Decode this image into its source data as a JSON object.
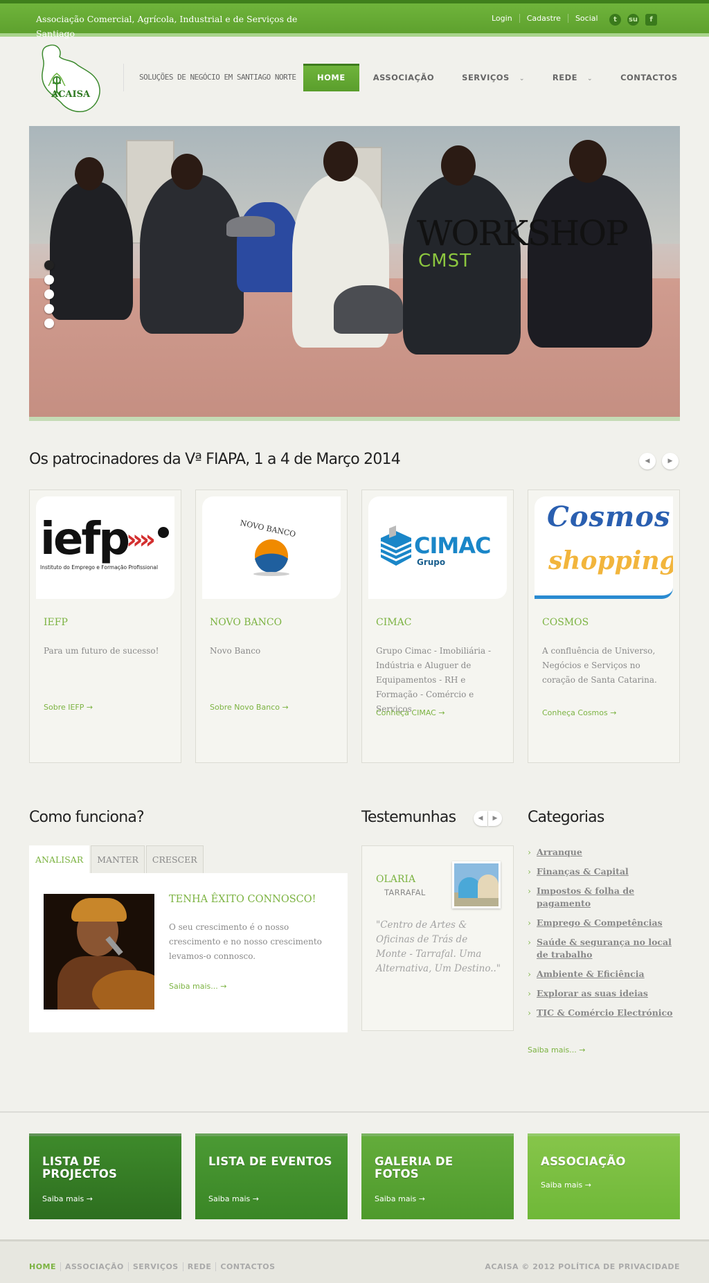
{
  "topbar": {
    "tagline": "Associação Comercial, Agrícola, Industrial e de Serviços de Santiago",
    "links": [
      "Login",
      "Cadastre",
      "Social"
    ],
    "socials": [
      {
        "icon": "twitter-bird-icon",
        "glyph": "t"
      },
      {
        "icon": "stumbleupon-icon",
        "glyph": "su"
      },
      {
        "icon": "facebook-icon",
        "glyph": "f"
      }
    ]
  },
  "header": {
    "logo_text": "ACAISA",
    "tagline": "SOLUÇÕES DE NEGÓCIO EM SANTIAGO NORTE",
    "nav": [
      {
        "label": "HOME",
        "active": true,
        "dropdown": false
      },
      {
        "label": "ASSOCIAÇÃO",
        "active": false,
        "dropdown": false
      },
      {
        "label": "SERVIÇOS",
        "active": false,
        "dropdown": true
      },
      {
        "label": "REDE",
        "active": false,
        "dropdown": true
      },
      {
        "label": "CONTACTOS",
        "active": false,
        "dropdown": false
      }
    ]
  },
  "slider": {
    "title": "WORKSHOP",
    "subtitle": "CMST",
    "slide_count": 5,
    "active_slide": 0
  },
  "sponsors": {
    "heading": "Os patrocinadores da Vª FIAPA, 1 a 4 de Março 2014",
    "cards": [
      {
        "name": "IEFP",
        "logo_main": "iefp",
        "logo_sub": "Instituto do Emprego e Formação Profissional",
        "description": "Para um futuro de sucesso!",
        "link": "Sobre IEFP"
      },
      {
        "name": "NOVO BANCO",
        "logo_main": "NOVO BANCO",
        "logo_sub": "",
        "description": "Novo Banco",
        "link": "Sobre Novo Banco"
      },
      {
        "name": "CIMAC",
        "logo_main": "CIMAC",
        "logo_sub": "Grupo",
        "description": "Grupo Cimac - Imobiliária - Indústria e Aluguer de Equipamentos - RH e Formação - Comércio e Serviços",
        "link": "Conheça CIMAC"
      },
      {
        "name": "COSMOS",
        "logo_main": "Cosmos",
        "logo_sub": "shopping",
        "description": "A confluência de Universo, Negócios e Serviços no coração de Santa Catarina.",
        "link": "Conheça Cosmos"
      }
    ]
  },
  "how_it_works": {
    "heading": "Como funciona?",
    "tabs": [
      "ANALISAR",
      "MANTER",
      "CRESCER"
    ],
    "active_tab": 0,
    "panel": {
      "heading": "TENHA ÊXITO CONNOSCO!",
      "text": "O seu crescimento é o nosso crescimento e no nosso crescimento levamos-o connosco.",
      "link": "Saiba mais..."
    }
  },
  "testimonials": {
    "heading": "Testemunhas",
    "name": "OLARIA",
    "place": "TARRAFAL",
    "quote": "\"Centro de Artes & Oficinas de Trás de Monte - Tarrafal. Uma Alternativa, Um Destino..\""
  },
  "categories": {
    "heading": "Categorias",
    "items": [
      "Arranque",
      "Finanças & Capital",
      "Impostos & folha de pagamento",
      "Emprego & Competências",
      "Saúde & segurança no local de trabalho",
      "Ambiente & Eficiência",
      "Explorar as suas ideias",
      "TIC & Comércio Electrónico"
    ],
    "link": "Saiba mais..."
  },
  "features": [
    {
      "title": "LISTA DE PROJECTOS",
      "link": "Saiba mais",
      "color_top": "#3e8a2b",
      "color_bottom": "#2d6e1f"
    },
    {
      "title": "LISTA DE EVENTOS",
      "link": "Saiba mais",
      "color_top": "#4b9a34",
      "color_bottom": "#3a8626"
    },
    {
      "title": "GALERIA DE FOTOS",
      "link": "Saiba mais",
      "color_top": "#63ac3b",
      "color_bottom": "#4e9a2c"
    },
    {
      "title": "ASSOCIAÇÃO",
      "link": "Saiba mais",
      "color_top": "#86c54a",
      "color_bottom": "#6fb838"
    }
  ],
  "footer": {
    "nav": [
      "HOME",
      "ASSOCIAÇÃO",
      "SERVIÇOS",
      "REDE",
      "CONTACTOS"
    ],
    "copyright": "ACAISA © 2012 POLÍTICA DE PRIVACIDADE"
  },
  "colors": {
    "accent": "#7cb342",
    "topbar": "#5ea12e",
    "background": "#f1f1ec"
  }
}
